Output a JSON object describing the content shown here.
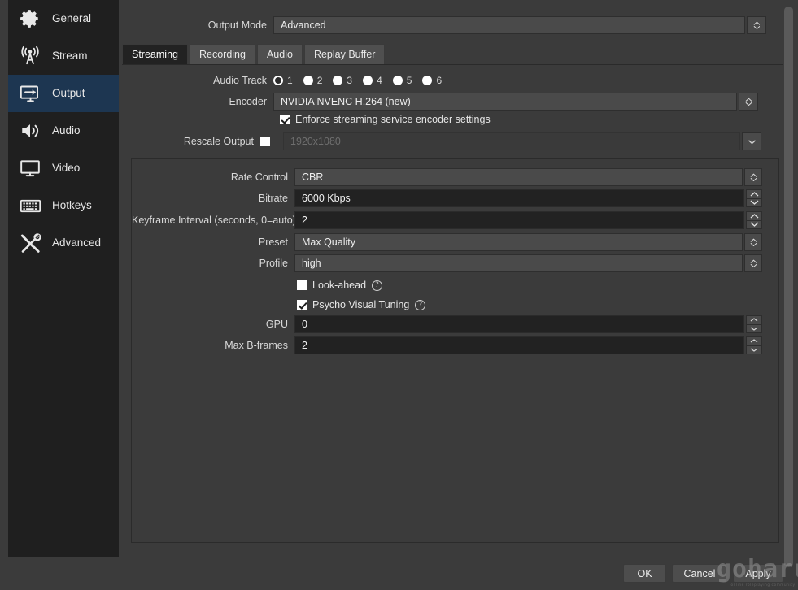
{
  "sidebar": {
    "items": [
      {
        "label": "General",
        "icon": "gear-icon",
        "active": false
      },
      {
        "label": "Stream",
        "icon": "broadcast-icon",
        "active": false
      },
      {
        "label": "Output",
        "icon": "output-icon",
        "active": true
      },
      {
        "label": "Audio",
        "icon": "speaker-icon",
        "active": false
      },
      {
        "label": "Video",
        "icon": "monitor-icon",
        "active": false
      },
      {
        "label": "Hotkeys",
        "icon": "keyboard-icon",
        "active": false
      },
      {
        "label": "Advanced",
        "icon": "tools-icon",
        "active": false
      }
    ]
  },
  "output_mode": {
    "label": "Output Mode",
    "value": "Advanced"
  },
  "tabs": [
    {
      "label": "Streaming",
      "active": true
    },
    {
      "label": "Recording",
      "active": false
    },
    {
      "label": "Audio",
      "active": false
    },
    {
      "label": "Replay Buffer",
      "active": false
    }
  ],
  "audio_track": {
    "label": "Audio Track",
    "options": [
      "1",
      "2",
      "3",
      "4",
      "5",
      "6"
    ],
    "selected": "1"
  },
  "encoder": {
    "label": "Encoder",
    "value": "NVIDIA NVENC H.264 (new)"
  },
  "enforce": {
    "label": "Enforce streaming service encoder settings",
    "checked": true
  },
  "rescale": {
    "label": "Rescale Output",
    "checked": false,
    "value": "1920x1080",
    "enabled": false
  },
  "encoder_settings": {
    "rate_control": {
      "label": "Rate Control",
      "value": "CBR"
    },
    "bitrate": {
      "label": "Bitrate",
      "value": "6000 Kbps"
    },
    "keyframe": {
      "label": "Keyframe Interval (seconds, 0=auto)",
      "value": "2"
    },
    "preset": {
      "label": "Preset",
      "value": "Max Quality"
    },
    "profile": {
      "label": "Profile",
      "value": "high"
    },
    "look_ahead": {
      "label": "Look-ahead",
      "checked": false,
      "help": "?"
    },
    "psycho_visual": {
      "label": "Psycho Visual Tuning",
      "checked": true,
      "help": "?"
    },
    "gpu": {
      "label": "GPU",
      "value": "0"
    },
    "max_b_frames": {
      "label": "Max B-frames",
      "value": "2"
    }
  },
  "buttons": {
    "ok": "OK",
    "cancel": "Cancel",
    "apply": "Apply"
  },
  "watermark": {
    "name": "goharu",
    "tagline": "online roleplaying community"
  },
  "colors": {
    "background": "#3b3b3b",
    "sidebar": "#1f1f1f",
    "accent_selected": "#1d3651",
    "field_dark": "#222222",
    "field_light": "#4a4a4a",
    "text": "#e6e6e6"
  }
}
